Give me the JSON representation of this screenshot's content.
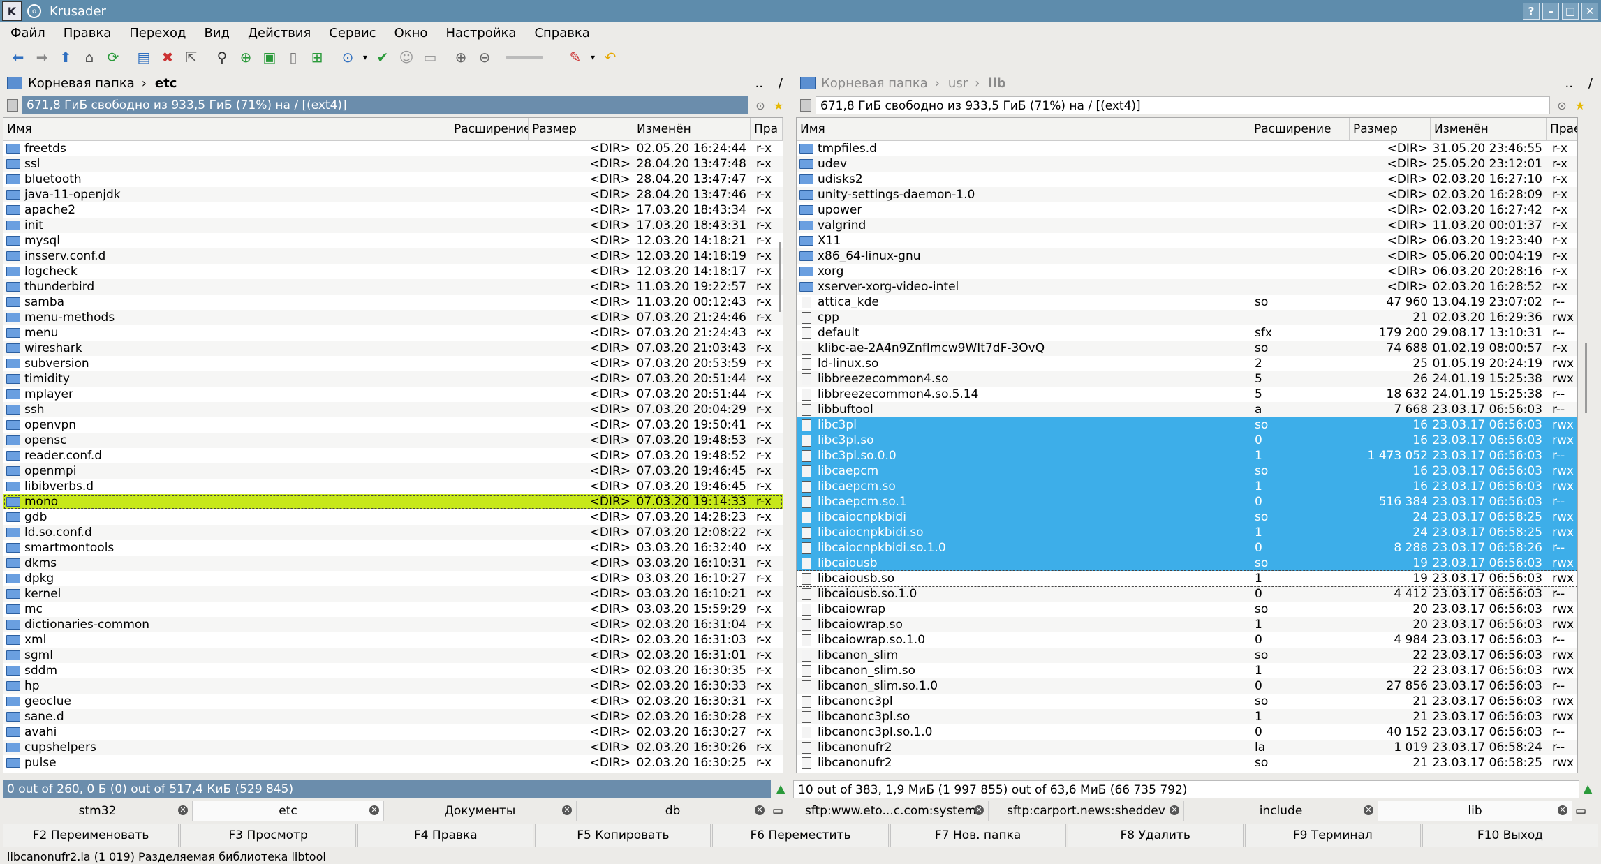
{
  "window": {
    "title": "Krusader",
    "buttons": [
      "?",
      "–",
      "□",
      "✕"
    ]
  },
  "menu": [
    "Файл",
    "Правка",
    "Переход",
    "Вид",
    "Действия",
    "Сервис",
    "Окно",
    "Настройка",
    "Справка"
  ],
  "toolbar_icons": [
    "back-arrow-icon",
    "forward-arrow-icon",
    "up-arrow-icon",
    "home-icon",
    "refresh-icon",
    "select-all-icon",
    "unselect-icon",
    "cursor-icon",
    "binoculars-icon",
    "new-tab-icon",
    "compare-icon",
    "notes-icon",
    "export-icon",
    "network-icon",
    "check-icon",
    "user-icon",
    "clipboard-icon",
    "zoom-in-icon",
    "zoom-out-icon",
    "clear-icon",
    "undo-icon"
  ],
  "left": {
    "crumbs": [
      "Корневая папка",
      "etc"
    ],
    "ups": "..",
    "slash": "/",
    "free": "671,8 ГиБ свободно из 933,5 ГиБ (71%) на / [(ext4)]",
    "headers": [
      "Имя",
      "Расширение",
      "Размер",
      "Изменён",
      "Пра"
    ],
    "rows": [
      {
        "name": "freetds",
        "ext": "",
        "size": "<DIR>",
        "date": "02.05.20 16:24:44",
        "perm": "r-x"
      },
      {
        "name": "ssl",
        "ext": "",
        "size": "<DIR>",
        "date": "28.04.20 13:47:48",
        "perm": "r-x"
      },
      {
        "name": "bluetooth",
        "ext": "",
        "size": "<DIR>",
        "date": "28.04.20 13:47:47",
        "perm": "r-x"
      },
      {
        "name": "java-11-openjdk",
        "ext": "",
        "size": "<DIR>",
        "date": "28.04.20 13:47:46",
        "perm": "r-x"
      },
      {
        "name": "apache2",
        "ext": "",
        "size": "<DIR>",
        "date": "17.03.20 18:43:34",
        "perm": "r-x"
      },
      {
        "name": "init",
        "ext": "",
        "size": "<DIR>",
        "date": "17.03.20 18:43:31",
        "perm": "r-x"
      },
      {
        "name": "mysql",
        "ext": "",
        "size": "<DIR>",
        "date": "12.03.20 14:18:21",
        "perm": "r-x"
      },
      {
        "name": "insserv.conf.d",
        "ext": "",
        "size": "<DIR>",
        "date": "12.03.20 14:18:19",
        "perm": "r-x"
      },
      {
        "name": "logcheck",
        "ext": "",
        "size": "<DIR>",
        "date": "12.03.20 14:18:17",
        "perm": "r-x"
      },
      {
        "name": "thunderbird",
        "ext": "",
        "size": "<DIR>",
        "date": "11.03.20 19:22:57",
        "perm": "r-x"
      },
      {
        "name": "samba",
        "ext": "",
        "size": "<DIR>",
        "date": "11.03.20 00:12:43",
        "perm": "r-x"
      },
      {
        "name": "menu-methods",
        "ext": "",
        "size": "<DIR>",
        "date": "07.03.20 21:24:46",
        "perm": "r-x"
      },
      {
        "name": "menu",
        "ext": "",
        "size": "<DIR>",
        "date": "07.03.20 21:24:43",
        "perm": "r-x"
      },
      {
        "name": "wireshark",
        "ext": "",
        "size": "<DIR>",
        "date": "07.03.20 21:03:43",
        "perm": "r-x"
      },
      {
        "name": "subversion",
        "ext": "",
        "size": "<DIR>",
        "date": "07.03.20 20:53:59",
        "perm": "r-x"
      },
      {
        "name": "timidity",
        "ext": "",
        "size": "<DIR>",
        "date": "07.03.20 20:51:44",
        "perm": "r-x"
      },
      {
        "name": "mplayer",
        "ext": "",
        "size": "<DIR>",
        "date": "07.03.20 20:51:44",
        "perm": "r-x"
      },
      {
        "name": "ssh",
        "ext": "",
        "size": "<DIR>",
        "date": "07.03.20 20:04:29",
        "perm": "r-x"
      },
      {
        "name": "openvpn",
        "ext": "",
        "size": "<DIR>",
        "date": "07.03.20 19:50:41",
        "perm": "r-x"
      },
      {
        "name": "opensc",
        "ext": "",
        "size": "<DIR>",
        "date": "07.03.20 19:48:53",
        "perm": "r-x"
      },
      {
        "name": "reader.conf.d",
        "ext": "",
        "size": "<DIR>",
        "date": "07.03.20 19:48:52",
        "perm": "r-x"
      },
      {
        "name": "openmpi",
        "ext": "",
        "size": "<DIR>",
        "date": "07.03.20 19:46:45",
        "perm": "r-x"
      },
      {
        "name": "libibverbs.d",
        "ext": "",
        "size": "<DIR>",
        "date": "07.03.20 19:46:45",
        "perm": "r-x"
      },
      {
        "name": "mono",
        "ext": "",
        "size": "<DIR>",
        "date": "07.03.20 19:14:33",
        "perm": "r-x",
        "current": true
      },
      {
        "name": "gdb",
        "ext": "",
        "size": "<DIR>",
        "date": "07.03.20 14:28:23",
        "perm": "r-x"
      },
      {
        "name": "ld.so.conf.d",
        "ext": "",
        "size": "<DIR>",
        "date": "07.03.20 12:08:22",
        "perm": "r-x"
      },
      {
        "name": "smartmontools",
        "ext": "",
        "size": "<DIR>",
        "date": "03.03.20 16:32:40",
        "perm": "r-x"
      },
      {
        "name": "dkms",
        "ext": "",
        "size": "<DIR>",
        "date": "03.03.20 16:10:31",
        "perm": "r-x"
      },
      {
        "name": "dpkg",
        "ext": "",
        "size": "<DIR>",
        "date": "03.03.20 16:10:27",
        "perm": "r-x"
      },
      {
        "name": "kernel",
        "ext": "",
        "size": "<DIR>",
        "date": "03.03.20 16:10:21",
        "perm": "r-x"
      },
      {
        "name": "mc",
        "ext": "",
        "size": "<DIR>",
        "date": "03.03.20 15:59:29",
        "perm": "r-x"
      },
      {
        "name": "dictionaries-common",
        "ext": "",
        "size": "<DIR>",
        "date": "02.03.20 16:31:04",
        "perm": "r-x"
      },
      {
        "name": "xml",
        "ext": "",
        "size": "<DIR>",
        "date": "02.03.20 16:31:03",
        "perm": "r-x"
      },
      {
        "name": "sgml",
        "ext": "",
        "size": "<DIR>",
        "date": "02.03.20 16:31:01",
        "perm": "r-x"
      },
      {
        "name": "sddm",
        "ext": "",
        "size": "<DIR>",
        "date": "02.03.20 16:30:35",
        "perm": "r-x"
      },
      {
        "name": "hp",
        "ext": "",
        "size": "<DIR>",
        "date": "02.03.20 16:30:33",
        "perm": "r-x"
      },
      {
        "name": "geoclue",
        "ext": "",
        "size": "<DIR>",
        "date": "02.03.20 16:30:31",
        "perm": "r-x"
      },
      {
        "name": "sane.d",
        "ext": "",
        "size": "<DIR>",
        "date": "02.03.20 16:30:28",
        "perm": "r-x"
      },
      {
        "name": "avahi",
        "ext": "",
        "size": "<DIR>",
        "date": "02.03.20 16:30:27",
        "perm": "r-x"
      },
      {
        "name": "cupshelpers",
        "ext": "",
        "size": "<DIR>",
        "date": "02.03.20 16:30:26",
        "perm": "r-x"
      },
      {
        "name": "pulse",
        "ext": "",
        "size": "<DIR>",
        "date": "02.03.20 16:30:25",
        "perm": "r-x"
      }
    ],
    "status": "0 out of 260, 0 Б (0) out of 517,4 КиБ (529 845)",
    "tabs": [
      "stm32",
      "etc",
      "Документы",
      "db"
    ],
    "active_tab": 1
  },
  "right": {
    "crumbs": [
      "Корневая папка",
      "usr",
      "lib"
    ],
    "ups": "..",
    "slash": "/",
    "free": "671,8 ГиБ свободно из 933,5 ГиБ (71%) на / [(ext4)]",
    "headers": [
      "Имя",
      "Расширение",
      "Размер",
      "Изменён",
      "Прае"
    ],
    "rows": [
      {
        "name": "tmpfiles.d",
        "ext": "",
        "size": "<DIR>",
        "date": "31.05.20 23:46:55",
        "perm": "r-x",
        "type": "dir"
      },
      {
        "name": "udev",
        "ext": "",
        "size": "<DIR>",
        "date": "25.05.20 23:12:01",
        "perm": "r-x",
        "type": "dir"
      },
      {
        "name": "udisks2",
        "ext": "",
        "size": "<DIR>",
        "date": "02.03.20 16:27:10",
        "perm": "r-x",
        "type": "dir"
      },
      {
        "name": "unity-settings-daemon-1.0",
        "ext": "",
        "size": "<DIR>",
        "date": "02.03.20 16:28:09",
        "perm": "r-x",
        "type": "dir"
      },
      {
        "name": "upower",
        "ext": "",
        "size": "<DIR>",
        "date": "02.03.20 16:27:42",
        "perm": "r-x",
        "type": "dir"
      },
      {
        "name": "valgrind",
        "ext": "",
        "size": "<DIR>",
        "date": "11.03.20 00:01:37",
        "perm": "r-x",
        "type": "dir"
      },
      {
        "name": "X11",
        "ext": "",
        "size": "<DIR>",
        "date": "06.03.20 19:23:40",
        "perm": "r-x",
        "type": "dir"
      },
      {
        "name": "x86_64-linux-gnu",
        "ext": "",
        "size": "<DIR>",
        "date": "05.06.20 00:04:19",
        "perm": "r-x",
        "type": "dir"
      },
      {
        "name": "xorg",
        "ext": "",
        "size": "<DIR>",
        "date": "06.03.20 20:28:16",
        "perm": "r-x",
        "type": "dir"
      },
      {
        "name": "xserver-xorg-video-intel",
        "ext": "",
        "size": "<DIR>",
        "date": "02.03.20 16:28:52",
        "perm": "r-x",
        "type": "dir"
      },
      {
        "name": "attica_kde",
        "ext": "so",
        "size": "47 960",
        "date": "13.04.19 23:07:02",
        "perm": "r--",
        "type": "file"
      },
      {
        "name": "cpp",
        "ext": "",
        "size": "21",
        "date": "02.03.20 16:29:36",
        "perm": "rwx",
        "type": "file"
      },
      {
        "name": "default",
        "ext": "sfx",
        "size": "179 200",
        "date": "29.08.17 13:10:31",
        "perm": "r--",
        "type": "file"
      },
      {
        "name": "klibc-ae-2A4n9ZnfImcw9WIt7dF-3OvQ",
        "ext": "so",
        "size": "74 688",
        "date": "01.02.19 08:00:57",
        "perm": "r-x",
        "type": "file"
      },
      {
        "name": "ld-linux.so",
        "ext": "2",
        "size": "25",
        "date": "01.05.19 20:24:19",
        "perm": "rwx",
        "type": "file"
      },
      {
        "name": "libbreezecommon4.so",
        "ext": "5",
        "size": "26",
        "date": "24.01.19 15:25:38",
        "perm": "rwx",
        "type": "file"
      },
      {
        "name": "libbreezecommon4.so.5.14",
        "ext": "5",
        "size": "18 632",
        "date": "24.01.19 15:25:38",
        "perm": "r--",
        "type": "file"
      },
      {
        "name": "libbuftool",
        "ext": "a",
        "size": "7 668",
        "date": "23.03.17 06:56:03",
        "perm": "r--",
        "type": "file"
      },
      {
        "name": "libc3pl",
        "ext": "so",
        "size": "16",
        "date": "23.03.17 06:56:03",
        "perm": "rwx",
        "type": "file",
        "selected": true
      },
      {
        "name": "libc3pl.so",
        "ext": "0",
        "size": "16",
        "date": "23.03.17 06:56:03",
        "perm": "rwx",
        "type": "file",
        "selected": true
      },
      {
        "name": "libc3pl.so.0.0",
        "ext": "1",
        "size": "1 473 052",
        "date": "23.03.17 06:56:03",
        "perm": "r--",
        "type": "file",
        "selected": true
      },
      {
        "name": "libcaepcm",
        "ext": "so",
        "size": "16",
        "date": "23.03.17 06:56:03",
        "perm": "rwx",
        "type": "file",
        "selected": true
      },
      {
        "name": "libcaepcm.so",
        "ext": "1",
        "size": "16",
        "date": "23.03.17 06:56:03",
        "perm": "rwx",
        "type": "file",
        "selected": true
      },
      {
        "name": "libcaepcm.so.1",
        "ext": "0",
        "size": "516 384",
        "date": "23.03.17 06:56:03",
        "perm": "r--",
        "type": "file",
        "selected": true
      },
      {
        "name": "libcaiocnpkbidi",
        "ext": "so",
        "size": "24",
        "date": "23.03.17 06:58:25",
        "perm": "rwx",
        "type": "file",
        "selected": true
      },
      {
        "name": "libcaiocnpkbidi.so",
        "ext": "1",
        "size": "24",
        "date": "23.03.17 06:58:25",
        "perm": "rwx",
        "type": "file",
        "selected": true
      },
      {
        "name": "libcaiocnpkbidi.so.1.0",
        "ext": "0",
        "size": "8 288",
        "date": "23.03.17 06:58:26",
        "perm": "r--",
        "type": "file",
        "selected": true
      },
      {
        "name": "libcaiousb",
        "ext": "so",
        "size": "19",
        "date": "23.03.17 06:56:03",
        "perm": "rwx",
        "type": "file",
        "selected": true
      },
      {
        "name": "libcaiousb.so",
        "ext": "1",
        "size": "19",
        "date": "23.03.17 06:56:03",
        "perm": "rwx",
        "type": "file",
        "cursor": true
      },
      {
        "name": "libcaiousb.so.1.0",
        "ext": "0",
        "size": "4 412",
        "date": "23.03.17 06:56:03",
        "perm": "r--",
        "type": "file"
      },
      {
        "name": "libcaiowrap",
        "ext": "so",
        "size": "20",
        "date": "23.03.17 06:56:03",
        "perm": "rwx",
        "type": "file"
      },
      {
        "name": "libcaiowrap.so",
        "ext": "1",
        "size": "20",
        "date": "23.03.17 06:56:03",
        "perm": "rwx",
        "type": "file"
      },
      {
        "name": "libcaiowrap.so.1.0",
        "ext": "0",
        "size": "4 984",
        "date": "23.03.17 06:56:03",
        "perm": "r--",
        "type": "file"
      },
      {
        "name": "libcanon_slim",
        "ext": "so",
        "size": "22",
        "date": "23.03.17 06:56:03",
        "perm": "rwx",
        "type": "file"
      },
      {
        "name": "libcanon_slim.so",
        "ext": "1",
        "size": "22",
        "date": "23.03.17 06:56:03",
        "perm": "rwx",
        "type": "file"
      },
      {
        "name": "libcanon_slim.so.1.0",
        "ext": "0",
        "size": "27 856",
        "date": "23.03.17 06:56:03",
        "perm": "r--",
        "type": "file"
      },
      {
        "name": "libcanonc3pl",
        "ext": "so",
        "size": "21",
        "date": "23.03.17 06:56:03",
        "perm": "rwx",
        "type": "file"
      },
      {
        "name": "libcanonc3pl.so",
        "ext": "1",
        "size": "21",
        "date": "23.03.17 06:56:03",
        "perm": "rwx",
        "type": "file"
      },
      {
        "name": "libcanonc3pl.so.1.0",
        "ext": "0",
        "size": "40 152",
        "date": "23.03.17 06:56:03",
        "perm": "r--",
        "type": "file"
      },
      {
        "name": "libcanonufr2",
        "ext": "la",
        "size": "1 019",
        "date": "23.03.17 06:58:24",
        "perm": "r--",
        "type": "file"
      },
      {
        "name": "libcanonufr2",
        "ext": "so",
        "size": "21",
        "date": "23.03.17 06:58:25",
        "perm": "rwx",
        "type": "file"
      }
    ],
    "status": "10 out of 383, 1,9 МиБ (1 997 855) out of 63,6 МиБ (66 735 792)",
    "tabs": [
      "sftp:www.eto...c.com:system",
      "sftp:carport.news:sheddev",
      "include",
      "lib"
    ],
    "active_tab": 3
  },
  "fkeys": [
    "F2 Переименовать",
    "F3 Просмотр",
    "F4 Правка",
    "F5 Копировать",
    "F6 Переместить",
    "F7 Нов. папка",
    "F8 Удалить",
    "F9 Терминал",
    "F10 Выход"
  ],
  "statusbar": "libcanonufr2.la  (1 019)  Разделяемая библиотека libtool"
}
